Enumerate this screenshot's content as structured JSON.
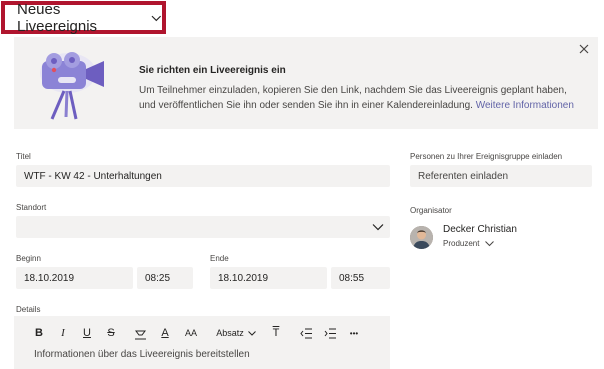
{
  "header": {
    "event_type": "Neues Liveereignis",
    "dropdown_icon": "chevron-down-icon",
    "highlight_color": "#b0152e"
  },
  "banner": {
    "title": "Sie richten ein Liveereignis ein",
    "text": "Um Teilnehmer einzuladen, kopieren Sie den Link, nachdem Sie das Liveereignis geplant haben, und veröffentlichen Sie ihn oder senden Sie ihn in einer Kalendereinladung.",
    "link": "Weitere Informationen",
    "close_icon": "close-icon",
    "illustration": "video-camera-illustration",
    "link_color": "#6264a7"
  },
  "form": {
    "title_label": "Titel",
    "title_value": "WTF - KW 42 - Unterhaltungen",
    "location_label": "Standort",
    "location_value": "",
    "start_label": "Beginn",
    "start_date": "18.10.2019",
    "start_time": "08:25",
    "end_label": "Ende",
    "end_date": "18.10.2019",
    "end_time": "08:55",
    "details_label": "Details",
    "details_placeholder": "Informationen über das Liveereignis bereitstellen"
  },
  "people": {
    "invite_label": "Personen zu Ihrer Ereignisgruppe einladen",
    "invite_placeholder": "Referenten einladen",
    "organizer_label": "Organisator",
    "organizer_name": "Decker Christian",
    "organizer_role": "Produzent"
  },
  "toolbar": {
    "bold": "B",
    "italic": "I",
    "underline": "U",
    "strike": "S",
    "font_color": "A",
    "font_size": "AA",
    "paragraph": "Absatz",
    "clear_format": "T",
    "more": "•••"
  }
}
